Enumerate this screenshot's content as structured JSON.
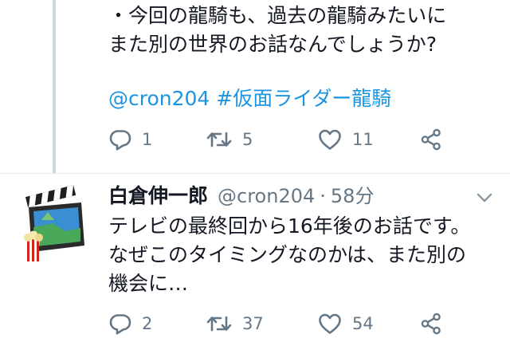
{
  "tweet1": {
    "lines": [
      "・今回の龍騎も、過去の龍騎みたいに",
      "また別の世界のお話なんでしょうか?"
    ],
    "mention": "@cron204",
    "hashtag": "#仮面ライダー龍騎",
    "replies": "1",
    "retweets": "5",
    "likes": "11"
  },
  "tweet2": {
    "display_name": "白倉伸一郎",
    "screen_name": "@cron204",
    "separator": "·",
    "timestamp": "58分",
    "lines": [
      "テレビの最終回から16年後のお話です。",
      "なぜこのタイミングなのかは、また別の",
      "機会に…"
    ],
    "replies": "2",
    "retweets": "37",
    "likes": "54"
  },
  "colors": {
    "link": "#1b95e0",
    "text": "#141823",
    "secondary": "#657786",
    "thread_line": "#ccd6dd"
  },
  "icons": {
    "reply": "reply-icon",
    "retweet": "retweet-icon",
    "like": "heart-icon",
    "share": "share-icon",
    "menu": "chevron-down-icon"
  }
}
